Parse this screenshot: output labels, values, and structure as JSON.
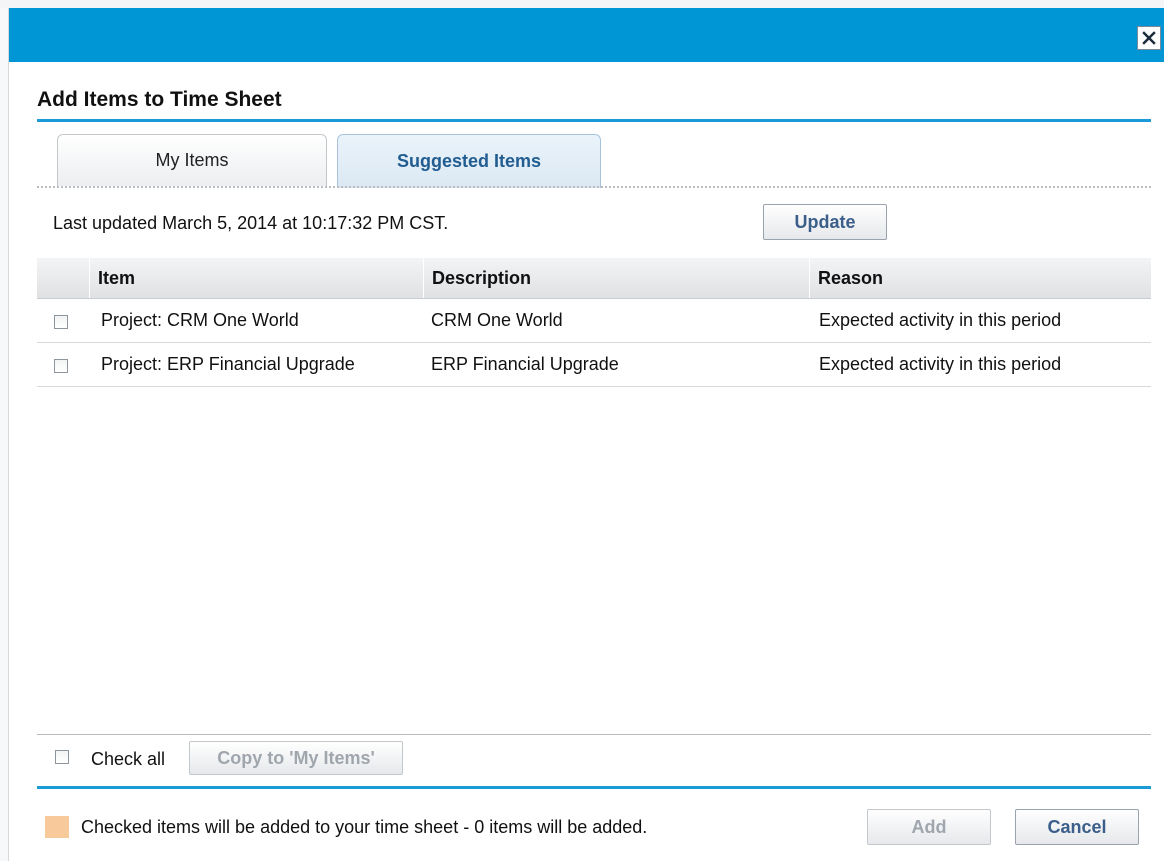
{
  "dialog": {
    "title": "Add Items to Time Sheet",
    "close_symbol": "✕"
  },
  "tabs": [
    {
      "label": "My Items",
      "active": false
    },
    {
      "label": "Suggested Items",
      "active": true
    }
  ],
  "suggested": {
    "last_updated": "Last updated March 5, 2014 at 10:17:32 PM CST.",
    "update_label": "Update"
  },
  "table": {
    "headers": {
      "item": "Item",
      "description": "Description",
      "reason": "Reason"
    },
    "rows": [
      {
        "item": "Project: CRM One World",
        "description": "CRM One World",
        "reason": "Expected activity in this period",
        "checked": false
      },
      {
        "item": "Project: ERP Financial Upgrade",
        "description": "ERP Financial Upgrade",
        "reason": "Expected activity in this period",
        "checked": false
      }
    ]
  },
  "footer": {
    "check_all_label": "Check all",
    "copy_label": "Copy to 'My Items'",
    "status": "Checked items will be added to your time sheet - 0 items will be added.",
    "add_label": "Add",
    "cancel_label": "Cancel"
  },
  "colors": {
    "title_bar": "#0096d6",
    "accent_rule": "#1a9ad6",
    "legend_swatch": "#f8c99a",
    "button_text": "#3b5f8a"
  },
  "icons": {
    "close": "close-icon"
  }
}
